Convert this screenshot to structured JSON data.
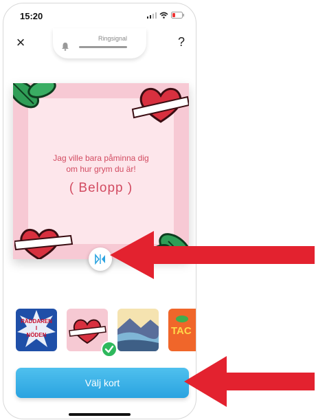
{
  "status_bar": {
    "time": "15:20"
  },
  "header": {
    "ringtone_label": "Ringsignal",
    "close_label": "×",
    "help_label": "?"
  },
  "card": {
    "line1": "Jag ville bara påminna dig",
    "line2": "om hur grym du är!",
    "amount": "( Belopp )"
  },
  "thumbnails": [
    {
      "text_line1": "RÄDDAREN",
      "text_line2": "I",
      "text_line3": "NÖDEN"
    },
    {
      "selected": true
    },
    {},
    {
      "text": "TAC"
    }
  ],
  "cta": {
    "label": "Välj kort"
  },
  "colors": {
    "accent": "#2aa3e0",
    "card_text": "#d24b61",
    "arrow": "#e3222f",
    "check": "#2eb85c"
  }
}
